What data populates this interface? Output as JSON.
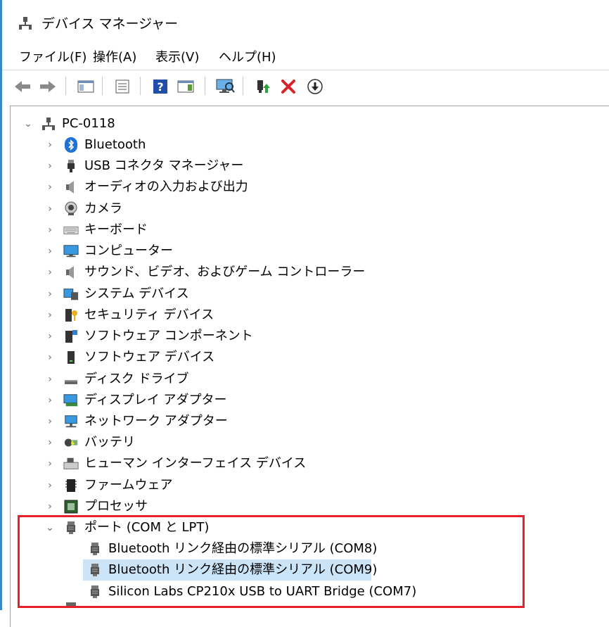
{
  "window": {
    "title": "デバイス マネージャー",
    "accent": "#3b88c8"
  },
  "menu": [
    {
      "label": "ファイル(F)"
    },
    {
      "label": "操作(A)"
    },
    {
      "label": "表示(V)"
    },
    {
      "label": "ヘルプ(H)"
    }
  ],
  "toolbar": [
    {
      "icon": "back-arrow-icon"
    },
    {
      "icon": "forward-arrow-icon"
    },
    {
      "icon": "show-hide-console-tree-icon"
    },
    {
      "icon": "properties-icon"
    },
    {
      "icon": "help-icon"
    },
    {
      "icon": "action-pane-icon"
    },
    {
      "icon": "scan-hardware-icon"
    },
    {
      "icon": "update-driver-icon"
    },
    {
      "icon": "uninstall-device-icon"
    },
    {
      "icon": "disable-device-icon"
    }
  ],
  "tree": {
    "root": {
      "label": "PC-0118",
      "expanded": true
    },
    "categories": [
      {
        "label": "Bluetooth",
        "icon": "bluetooth-icon"
      },
      {
        "label": "USB コネクタ マネージャー",
        "icon": "usb-icon"
      },
      {
        "label": "オーディオの入力および出力",
        "icon": "speaker-icon"
      },
      {
        "label": "カメラ",
        "icon": "camera-icon"
      },
      {
        "label": "キーボード",
        "icon": "keyboard-icon"
      },
      {
        "label": "コンピューター",
        "icon": "computer-icon"
      },
      {
        "label": "サウンド、ビデオ、およびゲーム コントローラー",
        "icon": "sound-icon"
      },
      {
        "label": "システム デバイス",
        "icon": "system-devices-icon"
      },
      {
        "label": "セキュリティ デバイス",
        "icon": "security-device-icon"
      },
      {
        "label": "ソフトウェア コンポーネント",
        "icon": "software-component-icon"
      },
      {
        "label": "ソフトウェア デバイス",
        "icon": "software-device-icon"
      },
      {
        "label": "ディスク ドライブ",
        "icon": "disk-drive-icon"
      },
      {
        "label": "ディスプレイ アダプター",
        "icon": "display-adapter-icon"
      },
      {
        "label": "ネットワーク アダプター",
        "icon": "network-adapter-icon"
      },
      {
        "label": "バッテリ",
        "icon": "battery-icon"
      },
      {
        "label": "ヒューマン インターフェイス デバイス",
        "icon": "hid-icon"
      },
      {
        "label": "ファームウェア",
        "icon": "firmware-icon"
      },
      {
        "label": "プロセッサ",
        "icon": "processor-icon"
      }
    ],
    "ports": {
      "label": "ポート (COM と LPT)",
      "expanded": true,
      "children": [
        {
          "label": "Bluetooth リンク経由の標準シリアル (COM8)"
        },
        {
          "label": "Bluetooth リンク経由の標準シリアル (COM9)",
          "selected": true
        },
        {
          "label": "Silicon Labs CP210x USB to UART Bridge (COM7)"
        }
      ]
    }
  },
  "colors": {
    "selection": "#cce4f7",
    "highlight_box": "#e8202a"
  }
}
